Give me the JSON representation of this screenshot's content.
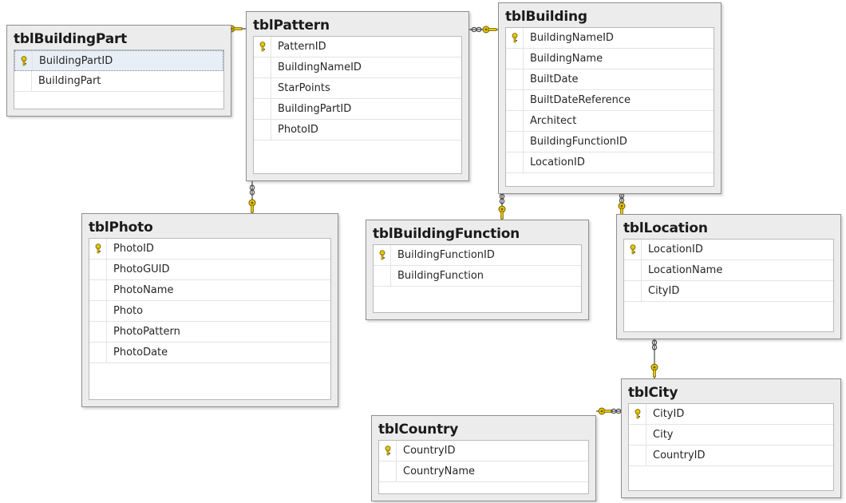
{
  "tables": [
    {
      "id": "tbl-building-part",
      "name": "tblBuildingPart",
      "columns": [
        {
          "name": "BuildingPartID",
          "pk": true,
          "selected": true
        },
        {
          "name": "BuildingPart",
          "pk": false
        }
      ]
    },
    {
      "id": "tbl-pattern",
      "name": "tblPattern",
      "columns": [
        {
          "name": "PatternID",
          "pk": true
        },
        {
          "name": "BuildingNameID",
          "pk": false
        },
        {
          "name": "StarPoints",
          "pk": false
        },
        {
          "name": "BuildingPartID",
          "pk": false
        },
        {
          "name": "PhotoID",
          "pk": false
        }
      ]
    },
    {
      "id": "tbl-building",
      "name": "tblBuilding",
      "columns": [
        {
          "name": "BuildingNameID",
          "pk": true
        },
        {
          "name": "BuildingName",
          "pk": false
        },
        {
          "name": "BuiltDate",
          "pk": false
        },
        {
          "name": "BuiltDateReference",
          "pk": false
        },
        {
          "name": "Architect",
          "pk": false
        },
        {
          "name": "BuildingFunctionID",
          "pk": false
        },
        {
          "name": "LocationID",
          "pk": false
        }
      ]
    },
    {
      "id": "tbl-photo",
      "name": "tblPhoto",
      "columns": [
        {
          "name": "PhotoID",
          "pk": true
        },
        {
          "name": "PhotoGUID",
          "pk": false
        },
        {
          "name": "PhotoName",
          "pk": false
        },
        {
          "name": "Photo",
          "pk": false
        },
        {
          "name": "PhotoPattern",
          "pk": false
        },
        {
          "name": "PhotoDate",
          "pk": false
        }
      ]
    },
    {
      "id": "tbl-building-function",
      "name": "tblBuildingFunction",
      "columns": [
        {
          "name": "BuildingFunctionID",
          "pk": true
        },
        {
          "name": "BuildingFunction",
          "pk": false
        }
      ]
    },
    {
      "id": "tbl-location",
      "name": "tblLocation",
      "columns": [
        {
          "name": "LocationID",
          "pk": true
        },
        {
          "name": "LocationName",
          "pk": false
        },
        {
          "name": "CityID",
          "pk": false
        }
      ]
    },
    {
      "id": "tbl-country",
      "name": "tblCountry",
      "columns": [
        {
          "name": "CountryID",
          "pk": true
        },
        {
          "name": "CountryName",
          "pk": false
        }
      ]
    },
    {
      "id": "tbl-city",
      "name": "tblCity",
      "columns": [
        {
          "name": "CityID",
          "pk": true
        },
        {
          "name": "City",
          "pk": false
        },
        {
          "name": "CountryID",
          "pk": false
        }
      ]
    }
  ],
  "relationships": [
    {
      "one": "tblBuildingPart",
      "many": "tblPattern"
    },
    {
      "one": "tblBuilding",
      "many": "tblPattern"
    },
    {
      "one": "tblPhoto",
      "many": "tblPattern"
    },
    {
      "one": "tblBuildingFunction",
      "many": "tblBuilding"
    },
    {
      "one": "tblLocation",
      "many": "tblBuilding"
    },
    {
      "one": "tblCity",
      "many": "tblLocation"
    },
    {
      "one": "tblCountry",
      "many": "tblCity"
    }
  ],
  "colors": {
    "key": "#e6c700",
    "key_outline": "#6b5a00",
    "line": "#4a4a4a",
    "canvas": "#ffffff",
    "table_bg": "#ececec"
  },
  "icons": {
    "primary_key": "key-icon",
    "relationship_one": "key-icon",
    "relationship_many": "infinity-icon"
  }
}
